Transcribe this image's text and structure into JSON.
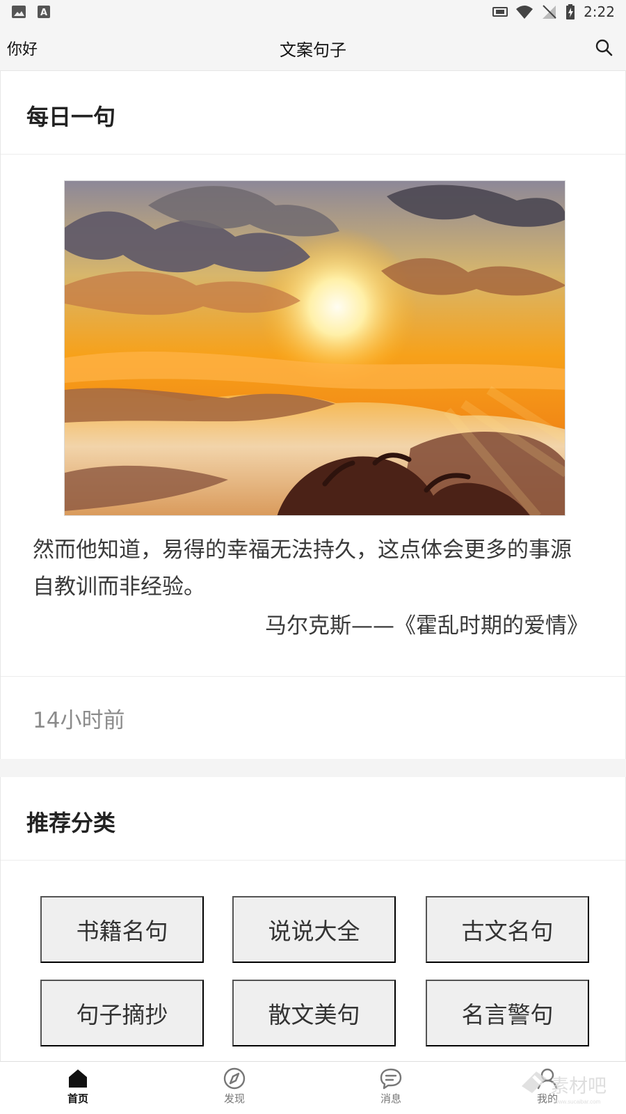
{
  "status_bar": {
    "time": "2:22",
    "left_icons": [
      "image-icon",
      "font-icon"
    ],
    "right_icons": [
      "cast-icon",
      "wifi-icon",
      "signal-icon",
      "battery-icon"
    ]
  },
  "app_bar": {
    "left_label": "你好",
    "title": "文案句子",
    "search_icon": "search-icon"
  },
  "daily": {
    "section_title": "每日一句",
    "image_icon": "sunset-image",
    "quote": "然而他知道，易得的幸福无法持久，这点体会更多的事源自教训而非经验。",
    "source": "马尔克斯——《霍乱时期的爱情》",
    "time": "14小时前"
  },
  "categories": {
    "section_title": "推荐分类",
    "items": [
      "书籍名句",
      "说说大全",
      "古文名句",
      "句子摘抄",
      "散文美句",
      "名言警句"
    ]
  },
  "bottom_nav": {
    "items": [
      {
        "label": "首页",
        "icon": "home-icon",
        "active": true
      },
      {
        "label": "发现",
        "icon": "compass-icon",
        "active": false
      },
      {
        "label": "消息",
        "icon": "message-icon",
        "active": false
      },
      {
        "label": "我的",
        "icon": "user-icon",
        "active": false
      }
    ]
  },
  "colors": {
    "background": "#f4f4f4",
    "card": "#ffffff",
    "button": "#efefef",
    "text": "#333333",
    "muted": "#8b8b8b"
  }
}
